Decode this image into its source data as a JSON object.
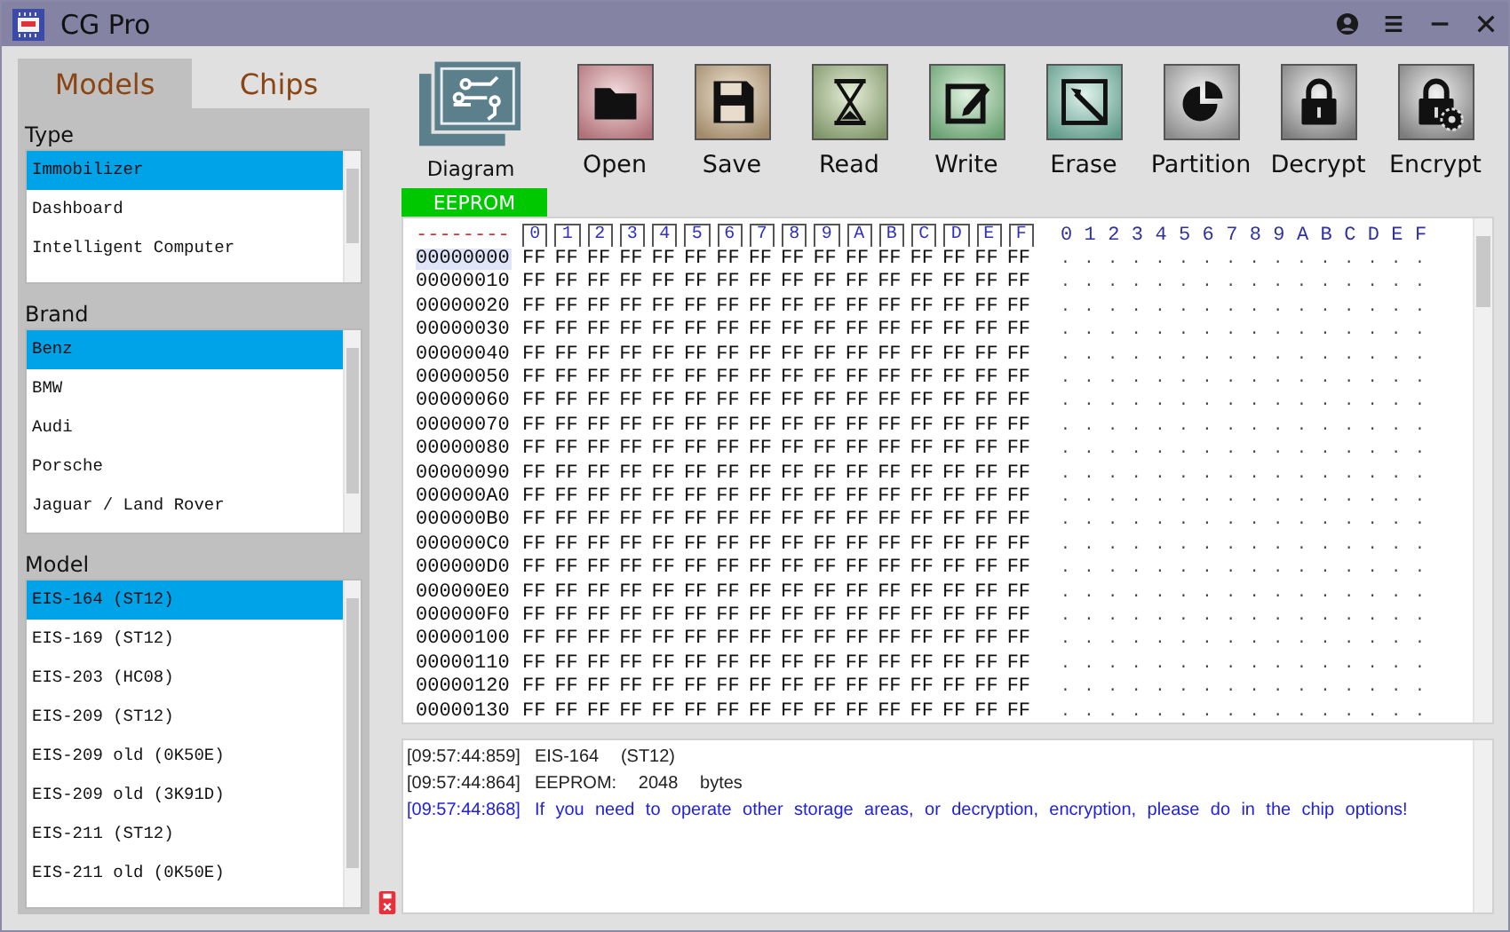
{
  "window": {
    "title": "CG Pro"
  },
  "tabs": [
    {
      "label": "Models",
      "selected": true
    },
    {
      "label": "Chips",
      "selected": false
    }
  ],
  "lists": [
    {
      "title": "Type",
      "items": [
        {
          "label": "Immobilizer",
          "selected": true
        },
        {
          "label": "Dashboard",
          "selected": false
        },
        {
          "label": "Intelligent Computer",
          "selected": false
        }
      ]
    },
    {
      "title": "Brand",
      "items": [
        {
          "label": "Benz",
          "selected": true
        },
        {
          "label": "BMW",
          "selected": false
        },
        {
          "label": "Audi",
          "selected": false
        },
        {
          "label": "Porsche",
          "selected": false
        },
        {
          "label": "Jaguar / Land Rover",
          "selected": false
        }
      ]
    },
    {
      "title": "Model",
      "items": [
        {
          "label": "EIS-164 (ST12)",
          "selected": true
        },
        {
          "label": "EIS-169 (ST12)",
          "selected": false
        },
        {
          "label": "EIS-203 (HC08)",
          "selected": false
        },
        {
          "label": "EIS-209 (ST12)",
          "selected": false
        },
        {
          "label": "EIS-209 old (0K50E)",
          "selected": false
        },
        {
          "label": "EIS-209 old (3K91D)",
          "selected": false
        },
        {
          "label": "EIS-211 (ST12)",
          "selected": false
        },
        {
          "label": "EIS-211 old (0K50E)",
          "selected": false
        }
      ]
    }
  ],
  "toolbar": [
    {
      "label": "Diagram",
      "kind": "diagram"
    },
    {
      "label": "Open",
      "kind": "folder"
    },
    {
      "label": "Save",
      "kind": "disk"
    },
    {
      "label": "Read",
      "kind": "hourglass"
    },
    {
      "label": "Write",
      "kind": "pencil"
    },
    {
      "label": "Erase",
      "kind": "wand"
    },
    {
      "label": "Partition",
      "kind": "pie"
    },
    {
      "label": "Decrypt",
      "kind": "lock"
    },
    {
      "label": "Encrypt",
      "kind": "lockgear"
    }
  ],
  "area_tab": "EEPROM",
  "hex": {
    "corner": "--------",
    "columns": [
      "0",
      "1",
      "2",
      "3",
      "4",
      "5",
      "6",
      "7",
      "8",
      "9",
      "A",
      "B",
      "C",
      "D",
      "E",
      "F"
    ],
    "ascii_columns": [
      "0",
      "1",
      "2",
      "3",
      "4",
      "5",
      "6",
      "7",
      "8",
      "9",
      "A",
      "B",
      "C",
      "D",
      "E",
      "F"
    ],
    "rows": [
      {
        "address": "00000000",
        "selected": true,
        "bytes": [
          "FF",
          "FF",
          "FF",
          "FF",
          "FF",
          "FF",
          "FF",
          "FF",
          "FF",
          "FF",
          "FF",
          "FF",
          "FF",
          "FF",
          "FF",
          "FF"
        ],
        "ascii": [
          ".",
          ".",
          ".",
          ".",
          ".",
          ".",
          ".",
          ".",
          ".",
          ".",
          ".",
          ".",
          ".",
          ".",
          ".",
          "."
        ]
      },
      {
        "address": "00000010",
        "selected": false,
        "bytes": [
          "FF",
          "FF",
          "FF",
          "FF",
          "FF",
          "FF",
          "FF",
          "FF",
          "FF",
          "FF",
          "FF",
          "FF",
          "FF",
          "FF",
          "FF",
          "FF"
        ],
        "ascii": [
          ".",
          ".",
          ".",
          ".",
          ".",
          ".",
          ".",
          ".",
          ".",
          ".",
          ".",
          ".",
          ".",
          ".",
          ".",
          "."
        ]
      },
      {
        "address": "00000020",
        "selected": false,
        "bytes": [
          "FF",
          "FF",
          "FF",
          "FF",
          "FF",
          "FF",
          "FF",
          "FF",
          "FF",
          "FF",
          "FF",
          "FF",
          "FF",
          "FF",
          "FF",
          "FF"
        ],
        "ascii": [
          ".",
          ".",
          ".",
          ".",
          ".",
          ".",
          ".",
          ".",
          ".",
          ".",
          ".",
          ".",
          ".",
          ".",
          ".",
          "."
        ]
      },
      {
        "address": "00000030",
        "selected": false,
        "bytes": [
          "FF",
          "FF",
          "FF",
          "FF",
          "FF",
          "FF",
          "FF",
          "FF",
          "FF",
          "FF",
          "FF",
          "FF",
          "FF",
          "FF",
          "FF",
          "FF"
        ],
        "ascii": [
          ".",
          ".",
          ".",
          ".",
          ".",
          ".",
          ".",
          ".",
          ".",
          ".",
          ".",
          ".",
          ".",
          ".",
          ".",
          "."
        ]
      },
      {
        "address": "00000040",
        "selected": false,
        "bytes": [
          "FF",
          "FF",
          "FF",
          "FF",
          "FF",
          "FF",
          "FF",
          "FF",
          "FF",
          "FF",
          "FF",
          "FF",
          "FF",
          "FF",
          "FF",
          "FF"
        ],
        "ascii": [
          ".",
          ".",
          ".",
          ".",
          ".",
          ".",
          ".",
          ".",
          ".",
          ".",
          ".",
          ".",
          ".",
          ".",
          ".",
          "."
        ]
      },
      {
        "address": "00000050",
        "selected": false,
        "bytes": [
          "FF",
          "FF",
          "FF",
          "FF",
          "FF",
          "FF",
          "FF",
          "FF",
          "FF",
          "FF",
          "FF",
          "FF",
          "FF",
          "FF",
          "FF",
          "FF"
        ],
        "ascii": [
          ".",
          ".",
          ".",
          ".",
          ".",
          ".",
          ".",
          ".",
          ".",
          ".",
          ".",
          ".",
          ".",
          ".",
          ".",
          "."
        ]
      },
      {
        "address": "00000060",
        "selected": false,
        "bytes": [
          "FF",
          "FF",
          "FF",
          "FF",
          "FF",
          "FF",
          "FF",
          "FF",
          "FF",
          "FF",
          "FF",
          "FF",
          "FF",
          "FF",
          "FF",
          "FF"
        ],
        "ascii": [
          ".",
          ".",
          ".",
          ".",
          ".",
          ".",
          ".",
          ".",
          ".",
          ".",
          ".",
          ".",
          ".",
          ".",
          ".",
          "."
        ]
      },
      {
        "address": "00000070",
        "selected": false,
        "bytes": [
          "FF",
          "FF",
          "FF",
          "FF",
          "FF",
          "FF",
          "FF",
          "FF",
          "FF",
          "FF",
          "FF",
          "FF",
          "FF",
          "FF",
          "FF",
          "FF"
        ],
        "ascii": [
          ".",
          ".",
          ".",
          ".",
          ".",
          ".",
          ".",
          ".",
          ".",
          ".",
          ".",
          ".",
          ".",
          ".",
          ".",
          "."
        ]
      },
      {
        "address": "00000080",
        "selected": false,
        "bytes": [
          "FF",
          "FF",
          "FF",
          "FF",
          "FF",
          "FF",
          "FF",
          "FF",
          "FF",
          "FF",
          "FF",
          "FF",
          "FF",
          "FF",
          "FF",
          "FF"
        ],
        "ascii": [
          ".",
          ".",
          ".",
          ".",
          ".",
          ".",
          ".",
          ".",
          ".",
          ".",
          ".",
          ".",
          ".",
          ".",
          ".",
          "."
        ]
      },
      {
        "address": "00000090",
        "selected": false,
        "bytes": [
          "FF",
          "FF",
          "FF",
          "FF",
          "FF",
          "FF",
          "FF",
          "FF",
          "FF",
          "FF",
          "FF",
          "FF",
          "FF",
          "FF",
          "FF",
          "FF"
        ],
        "ascii": [
          ".",
          ".",
          ".",
          ".",
          ".",
          ".",
          ".",
          ".",
          ".",
          ".",
          ".",
          ".",
          ".",
          ".",
          ".",
          "."
        ]
      },
      {
        "address": "000000A0",
        "selected": false,
        "bytes": [
          "FF",
          "FF",
          "FF",
          "FF",
          "FF",
          "FF",
          "FF",
          "FF",
          "FF",
          "FF",
          "FF",
          "FF",
          "FF",
          "FF",
          "FF",
          "FF"
        ],
        "ascii": [
          ".",
          ".",
          ".",
          ".",
          ".",
          ".",
          ".",
          ".",
          ".",
          ".",
          ".",
          ".",
          ".",
          ".",
          ".",
          "."
        ]
      },
      {
        "address": "000000B0",
        "selected": false,
        "bytes": [
          "FF",
          "FF",
          "FF",
          "FF",
          "FF",
          "FF",
          "FF",
          "FF",
          "FF",
          "FF",
          "FF",
          "FF",
          "FF",
          "FF",
          "FF",
          "FF"
        ],
        "ascii": [
          ".",
          ".",
          ".",
          ".",
          ".",
          ".",
          ".",
          ".",
          ".",
          ".",
          ".",
          ".",
          ".",
          ".",
          ".",
          "."
        ]
      },
      {
        "address": "000000C0",
        "selected": false,
        "bytes": [
          "FF",
          "FF",
          "FF",
          "FF",
          "FF",
          "FF",
          "FF",
          "FF",
          "FF",
          "FF",
          "FF",
          "FF",
          "FF",
          "FF",
          "FF",
          "FF"
        ],
        "ascii": [
          ".",
          ".",
          ".",
          ".",
          ".",
          ".",
          ".",
          ".",
          ".",
          ".",
          ".",
          ".",
          ".",
          ".",
          ".",
          "."
        ]
      },
      {
        "address": "000000D0",
        "selected": false,
        "bytes": [
          "FF",
          "FF",
          "FF",
          "FF",
          "FF",
          "FF",
          "FF",
          "FF",
          "FF",
          "FF",
          "FF",
          "FF",
          "FF",
          "FF",
          "FF",
          "FF"
        ],
        "ascii": [
          ".",
          ".",
          ".",
          ".",
          ".",
          ".",
          ".",
          ".",
          ".",
          ".",
          ".",
          ".",
          ".",
          ".",
          ".",
          "."
        ]
      },
      {
        "address": "000000E0",
        "selected": false,
        "bytes": [
          "FF",
          "FF",
          "FF",
          "FF",
          "FF",
          "FF",
          "FF",
          "FF",
          "FF",
          "FF",
          "FF",
          "FF",
          "FF",
          "FF",
          "FF",
          "FF"
        ],
        "ascii": [
          ".",
          ".",
          ".",
          ".",
          ".",
          ".",
          ".",
          ".",
          ".",
          ".",
          ".",
          ".",
          ".",
          ".",
          ".",
          "."
        ]
      },
      {
        "address": "000000F0",
        "selected": false,
        "bytes": [
          "FF",
          "FF",
          "FF",
          "FF",
          "FF",
          "FF",
          "FF",
          "FF",
          "FF",
          "FF",
          "FF",
          "FF",
          "FF",
          "FF",
          "FF",
          "FF"
        ],
        "ascii": [
          ".",
          ".",
          ".",
          ".",
          ".",
          ".",
          ".",
          ".",
          ".",
          ".",
          ".",
          ".",
          ".",
          ".",
          ".",
          "."
        ]
      },
      {
        "address": "00000100",
        "selected": false,
        "bytes": [
          "FF",
          "FF",
          "FF",
          "FF",
          "FF",
          "FF",
          "FF",
          "FF",
          "FF",
          "FF",
          "FF",
          "FF",
          "FF",
          "FF",
          "FF",
          "FF"
        ],
        "ascii": [
          ".",
          ".",
          ".",
          ".",
          ".",
          ".",
          ".",
          ".",
          ".",
          ".",
          ".",
          ".",
          ".",
          ".",
          ".",
          "."
        ]
      },
      {
        "address": "00000110",
        "selected": false,
        "bytes": [
          "FF",
          "FF",
          "FF",
          "FF",
          "FF",
          "FF",
          "FF",
          "FF",
          "FF",
          "FF",
          "FF",
          "FF",
          "FF",
          "FF",
          "FF",
          "FF"
        ],
        "ascii": [
          ".",
          ".",
          ".",
          ".",
          ".",
          ".",
          ".",
          ".",
          ".",
          ".",
          ".",
          ".",
          ".",
          ".",
          ".",
          "."
        ]
      },
      {
        "address": "00000120",
        "selected": false,
        "bytes": [
          "FF",
          "FF",
          "FF",
          "FF",
          "FF",
          "FF",
          "FF",
          "FF",
          "FF",
          "FF",
          "FF",
          "FF",
          "FF",
          "FF",
          "FF",
          "FF"
        ],
        "ascii": [
          ".",
          ".",
          ".",
          ".",
          ".",
          ".",
          ".",
          ".",
          ".",
          ".",
          ".",
          ".",
          ".",
          ".",
          ".",
          "."
        ]
      },
      {
        "address": "00000130",
        "selected": false,
        "bytes": [
          "FF",
          "FF",
          "FF",
          "FF",
          "FF",
          "FF",
          "FF",
          "FF",
          "FF",
          "FF",
          "FF",
          "FF",
          "FF",
          "FF",
          "FF",
          "FF"
        ],
        "ascii": [
          ".",
          ".",
          ".",
          ".",
          ".",
          ".",
          ".",
          ".",
          ".",
          ".",
          ".",
          ".",
          ".",
          ".",
          ".",
          "."
        ]
      }
    ]
  },
  "log": [
    {
      "time": "[09:57:44:859]",
      "text": "EIS-164  (ST12)",
      "kind": "normal"
    },
    {
      "time": "[09:57:44:864]",
      "text": "EEPROM:  2048  bytes",
      "kind": "normal"
    },
    {
      "time": "[09:57:44:868]",
      "text": "If you need to operate other storage areas, or decryption, encryption, please do in the chip options!",
      "kind": "hint"
    }
  ]
}
